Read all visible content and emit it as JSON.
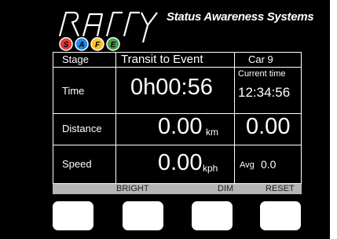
{
  "brand": {
    "logo_text": "rally",
    "logo_badge_letters": [
      "S",
      "A",
      "F",
      "E"
    ],
    "tagline": "Status Awareness Systems"
  },
  "stage": {
    "label": "Stage",
    "value": "Transit to Event",
    "car": "Car 9"
  },
  "time": {
    "label": "Time",
    "value": "0h00:56",
    "current_label": "Current time",
    "current_value": "12:34:56"
  },
  "distance": {
    "label": "Distance",
    "value": "0.00",
    "unit": "km",
    "secondary": "0.00"
  },
  "speed": {
    "label": "Speed",
    "value": "0.00",
    "unit": "kph",
    "avg_label": "Avg",
    "avg_value": "0.0"
  },
  "softkeys": {
    "bright": "BRIGHT",
    "dim": "DIM",
    "reset": "RESET"
  },
  "colors": {
    "badge": [
      "#e53935",
      "#1e88e5",
      "#fbc02d",
      "#43a047"
    ]
  }
}
